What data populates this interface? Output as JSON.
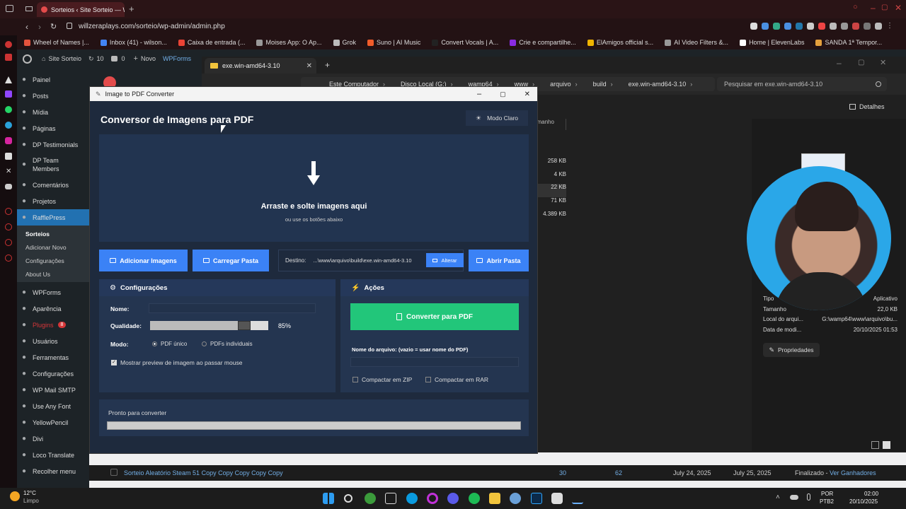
{
  "browser": {
    "tab_title": "Sorteios ‹ Site Sorteio — W",
    "url": "willzeraplays.com/sorteio/wp-admin/admin.php",
    "bookmarks": [
      {
        "label": "Wheel of Names |...",
        "color": "#e5533d"
      },
      {
        "label": "Inbox (41) - wilson...",
        "color": "#4285f4"
      },
      {
        "label": "Caixa de entrada (...",
        "color": "#ea4335"
      },
      {
        "label": "Moises App: O Ap...",
        "color": "#999"
      },
      {
        "label": "Grok",
        "color": "#bbb"
      },
      {
        "label": "Suno | AI Music",
        "color": "#f25c2a"
      },
      {
        "label": "Convert Vocals | A...",
        "color": "#222"
      },
      {
        "label": "Crie e compartilhe...",
        "color": "#8a2be2"
      },
      {
        "label": "ElAmigos official s...",
        "color": "#f0b400"
      },
      {
        "label": "AI Video Filters &...",
        "color": "#999"
      },
      {
        "label": "Home | ElevenLabs",
        "color": "#fff"
      },
      {
        "label": "SANDA 1ª Tempor...",
        "color": "#e5a03d"
      }
    ]
  },
  "wp": {
    "site": "Site Sorteio",
    "updates": "10",
    "comments": "0",
    "new": "Novo",
    "wpforms": "WPForms",
    "menu": [
      {
        "label": "Painel",
        "icon": "dashboard-icon"
      },
      {
        "label": "Posts",
        "icon": "pin-icon"
      },
      {
        "label": "Mídia",
        "icon": "media-icon"
      },
      {
        "label": "Páginas",
        "icon": "page-icon"
      },
      {
        "label": "DP Testimonials",
        "icon": "list-icon"
      },
      {
        "label": "DP Team Members",
        "icon": "list-icon"
      },
      {
        "label": "Comentários",
        "icon": "comment-icon"
      },
      {
        "label": "Projetos",
        "icon": "pin-icon"
      },
      {
        "label": "RafflePress",
        "icon": "rafflepress-icon"
      }
    ],
    "submenu": [
      "Sorteios",
      "Adicionar Novo",
      "Configurações",
      "About Us"
    ],
    "menu2": [
      {
        "label": "WPForms",
        "icon": "forms-icon"
      },
      {
        "label": "Aparência",
        "icon": "brush-icon"
      },
      {
        "label": "Plugins",
        "icon": "plugin-icon",
        "badge": "8"
      },
      {
        "label": "Usuários",
        "icon": "user-icon"
      },
      {
        "label": "Ferramentas",
        "icon": "wrench-icon"
      },
      {
        "label": "Configurações",
        "icon": "settings-icon"
      },
      {
        "label": "WP Mail SMTP",
        "icon": "mail-icon"
      },
      {
        "label": "Use Any Font",
        "icon": "font-icon"
      },
      {
        "label": "YellowPencil",
        "icon": "pencil-icon"
      },
      {
        "label": "Divi",
        "icon": "divi-icon"
      },
      {
        "label": "Loco Translate",
        "icon": "translate-icon"
      },
      {
        "label": "Recolher menu",
        "icon": "collapse-icon"
      }
    ],
    "row": {
      "title": "Sorteio Aleatório Steam 51 Copy Copy Copy Copy Copy",
      "entries": "30",
      "users": "62",
      "start": "July 24, 2025",
      "end": "July 25, 2025",
      "status": "Finalizado - ",
      "winners": "Ver Ganhadores"
    }
  },
  "explorer": {
    "tab_title": "exe.win-amd64-3.10",
    "crumbs": [
      "Este Computador",
      "Disco Local (G:)",
      "wamp64",
      "www",
      "arquivo",
      "build",
      "exe.win-amd64-3.10"
    ],
    "search_placeholder": "Pesquisar em exe.win-amd64-3.10",
    "details": "Detalhes",
    "col_size": "Tamanho",
    "sizes": [
      "258 KB",
      "4 KB",
      "22 KB",
      "71 KB",
      "4.389 KB"
    ],
    "props": [
      {
        "k": "Tipo",
        "v": "Aplicativo"
      },
      {
        "k": "Tamanho",
        "v": "22,0 KB"
      },
      {
        "k": "Local do arqui...",
        "v": "G:\\wamp64\\www\\arquivo\\bu..."
      },
      {
        "k": "Data de modi...",
        "v": "20/10/2025 01:53"
      }
    ],
    "props_button": "Propriedades"
  },
  "app": {
    "window_title": "Image to PDF Converter",
    "heading": "Conversor de Imagens para PDF",
    "theme_button": "Modo Claro",
    "drop_title": "Arraste e solte imagens aqui",
    "drop_sub": "ou use os botões abaixo",
    "add_images": "Adicionar Imagens",
    "load_folder": "Carregar Pasta",
    "dest_label": "Destino:",
    "dest_path": "...\\www\\arquivo\\build\\exe.win-amd64-3.10",
    "change": "Alterar",
    "open_folder": "Abrir Pasta",
    "settings_title": "Configurações",
    "name_label": "Nome:",
    "name_value": "",
    "quality_label": "Qualidade:",
    "quality_value": "85%",
    "quality_fraction": 0.85,
    "mode_label": "Modo:",
    "mode_single": "PDF único",
    "mode_multi": "PDFs individuais",
    "preview_label": "Mostrar preview de imagem ao passar mouse",
    "actions_title": "Ações",
    "convert": "Converter para PDF",
    "filename_label": "Nome do arquivo: (vazio = usar nome do PDF)",
    "zip": "Compactar em ZIP",
    "rar": "Compactar em RAR",
    "status": "Pronto para converter"
  },
  "taskbar": {
    "weather_temp": "12°C",
    "weather_desc": "Limpo",
    "lang1": "POR",
    "lang2": "PTB2",
    "time": "02:00",
    "date": "20/10/2025"
  },
  "colors": {
    "accent": "#3b82f6",
    "convert": "#22c67a",
    "wp_active": "#2271b1"
  }
}
